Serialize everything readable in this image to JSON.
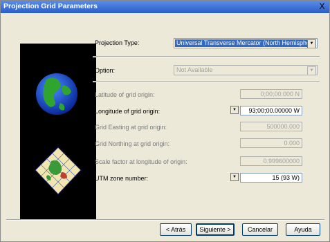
{
  "window": {
    "title": "Projection Grid Parameters",
    "close_label": "X"
  },
  "projection_type": {
    "label": "Projection Type:",
    "value": "Universal Transverse Mercator (North Hemisphere)"
  },
  "option": {
    "label": "Option:",
    "value": "Not Available"
  },
  "fields": {
    "latitude": {
      "label": "Latitude of grid origin:",
      "value": "0;00;00.000 N"
    },
    "longitude": {
      "label": "Longitude of grid origin:",
      "value": "93;00;00.00000 W"
    },
    "easting": {
      "label": "Grid Easting at grid origin:",
      "value": "500000.000"
    },
    "northing": {
      "label": "Grid Northing at grid origin:",
      "value": "0.000"
    },
    "scale": {
      "label": "Scale factor at longitude of origin:",
      "value": "0.999600000"
    },
    "utm_zone": {
      "label": "UTM zone number:",
      "value": "15  (93 W)"
    }
  },
  "buttons": {
    "back": "< Atrás",
    "next": "Siguiente >",
    "cancel": "Cancelar",
    "help": "Ayuda"
  },
  "icons": {
    "globe": "globe-icon",
    "grid_diamond": "grid-diamond-icon",
    "dropdown": "dropdown-arrow-icon"
  }
}
